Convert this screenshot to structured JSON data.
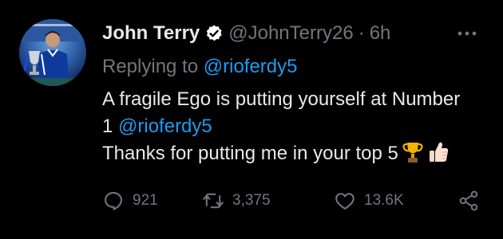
{
  "tweet": {
    "author": {
      "display_name": "John Terry",
      "handle": "@JohnTerry26",
      "separator": "·",
      "time": "6h",
      "verified": true
    },
    "reply": {
      "prefix": "Replying to ",
      "mention": "@rioferdy5"
    },
    "body": {
      "line1": "A fragile Ego is putting yourself at Number",
      "line2_prefix": "1 ",
      "line2_mention": "@rioferdy5",
      "line3": "Thanks for putting me in your top 5"
    },
    "emojis": [
      "trophy-icon",
      "thumbs-up-icon"
    ],
    "stats": {
      "replies": "921",
      "retweets": "3,375",
      "likes": "13.6K"
    }
  },
  "colors": {
    "background": "#000000",
    "text": "#e7e9ea",
    "secondary": "#71767b",
    "accent": "#1d9bf0"
  },
  "icons": [
    "verified-badge-icon",
    "more-dots-icon",
    "reply-icon",
    "retweet-icon",
    "like-icon",
    "share-icon"
  ]
}
